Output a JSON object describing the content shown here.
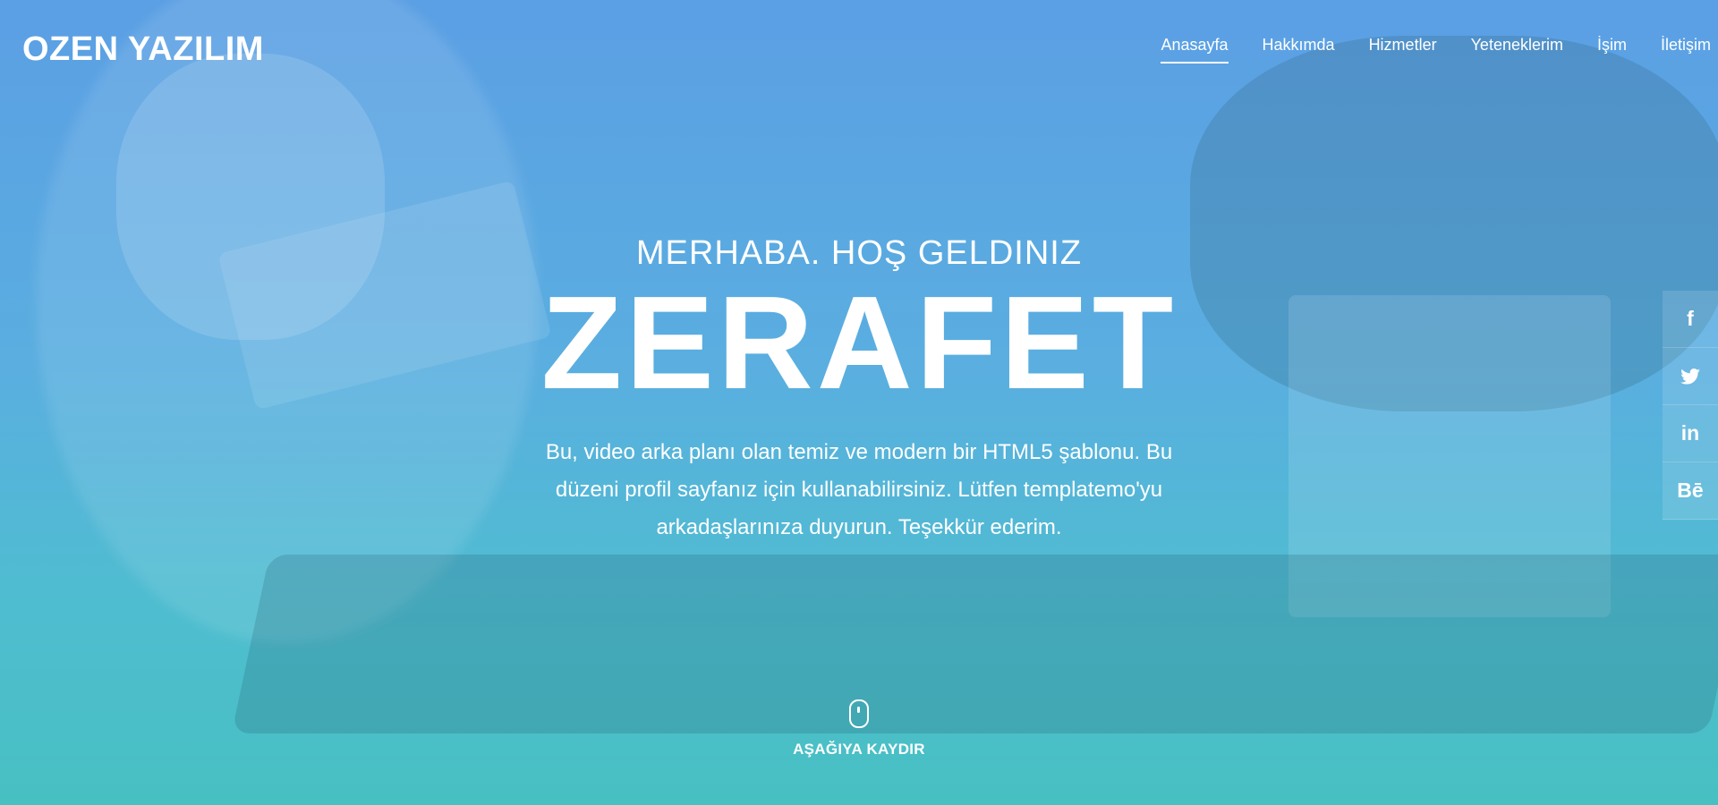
{
  "brand": {
    "name": "OZEN YAZILIM"
  },
  "nav": {
    "items": [
      {
        "label": "Anasayfa",
        "active": true
      },
      {
        "label": "Hakkımda",
        "active": false
      },
      {
        "label": "Hizmetler",
        "active": false
      },
      {
        "label": "Yeteneklerim",
        "active": false
      },
      {
        "label": "İşim",
        "active": false
      },
      {
        "label": "İletişim",
        "active": false
      }
    ]
  },
  "hero": {
    "subtitle": "MERHABA. HOŞ GELDINIZ",
    "title": "ZERAFET",
    "description": "Bu, video arka planı olan temiz ve modern bir HTML5 şablonu. Bu düzeni profil sayfanız için kullanabilirsiniz. Lütfen templatemo'yu arkadaşlarınıza duyurun. Teşekkür ederim."
  },
  "social": {
    "items": [
      {
        "icon": "facebook-icon",
        "glyph": "f"
      },
      {
        "icon": "twitter-icon",
        "glyph": "🐦"
      },
      {
        "icon": "linkedin-icon",
        "glyph": "in"
      },
      {
        "icon": "behance-icon",
        "glyph": "Bē"
      }
    ]
  },
  "scroll": {
    "label": "AŞAĞIYA KAYDIR",
    "icon": "mouse-icon"
  },
  "colors": {
    "overlay_top": "#5b9fe4",
    "overlay_bottom": "#47c0c2",
    "text": "#ffffff"
  }
}
